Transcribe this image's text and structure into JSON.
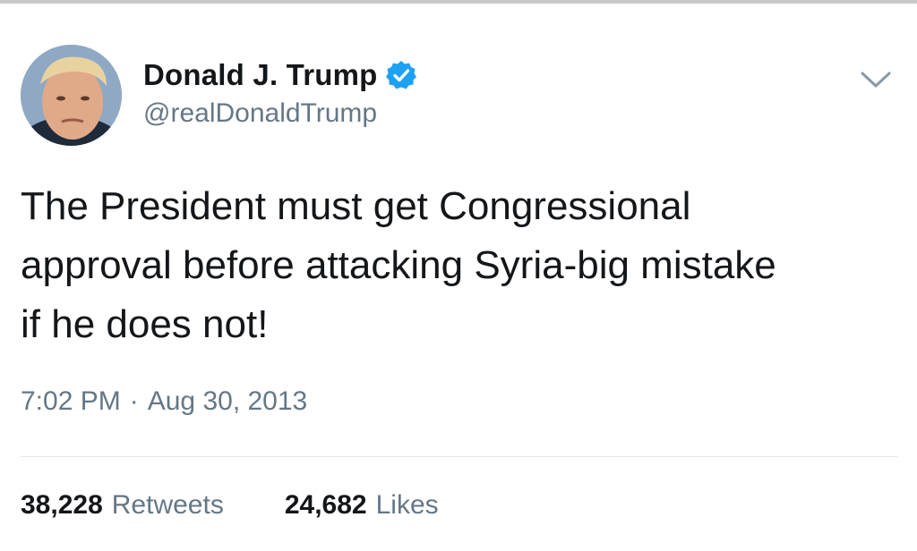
{
  "author": {
    "display_name": "Donald J. Trump",
    "handle": "@realDonaldTrump",
    "verified_icon": "verified-badge-icon",
    "avatar_icon": "avatar-photo"
  },
  "menu": {
    "icon": "chevron-down-icon"
  },
  "tweet": {
    "text": "The President must get Congressional\napproval before attacking Syria-big mistake\nif he does not!",
    "time": "7:02 PM",
    "separator": "·",
    "date": "Aug 30, 2013"
  },
  "stats": {
    "retweets_count": "38,228",
    "retweets_label": "Retweets",
    "likes_count": "24,682",
    "likes_label": "Likes"
  },
  "colors": {
    "text_primary": "#14171a",
    "text_secondary": "#657786",
    "verified_blue": "#1da1f2",
    "divider": "#e1e8ed"
  }
}
